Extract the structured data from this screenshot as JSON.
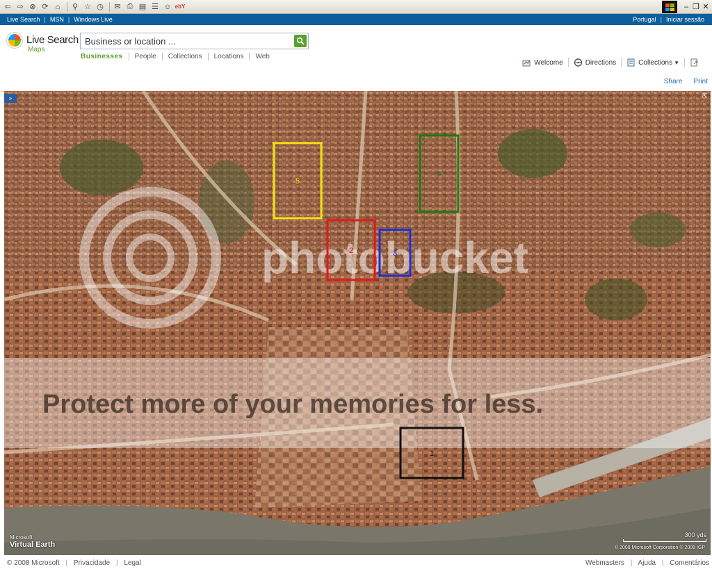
{
  "browser": {
    "toolbar_icons": [
      "back-icon",
      "forward-icon",
      "stop-icon",
      "refresh-icon",
      "home-icon",
      "search-icon",
      "favorites-icon",
      "history-icon",
      "mail-icon",
      "print-icon",
      "edit-icon",
      "discuss-icon",
      "messenger-icon",
      "ebay-icon"
    ],
    "ebay_label": "ebY"
  },
  "live_bar": {
    "links": [
      "Live Search",
      "MSN",
      "Windows Live"
    ],
    "right_links": [
      "Portugal",
      "Iniciar sessão"
    ]
  },
  "header": {
    "logo_title": "Live Search",
    "logo_subtitle": "Maps",
    "search_placeholder": "Business or location ...",
    "tabs": [
      "Businesses",
      "People",
      "Collections",
      "Locations",
      "Web"
    ],
    "actions": [
      "Welcome",
      "Directions",
      "Collections"
    ],
    "share": "Share",
    "print": "Print"
  },
  "map": {
    "expand_label": "»",
    "markers": [
      {
        "label": "1",
        "color": "#111111"
      },
      {
        "label": "2",
        "color": "#e01b1b"
      },
      {
        "label": "3",
        "color": "#1a2fd6"
      },
      {
        "label": "4",
        "color": "#1e7a12"
      },
      {
        "label": "5",
        "color": "#f2e313"
      }
    ],
    "watermark_brand": "photobucket",
    "watermark_banner": "Protect more of your memories for less.",
    "ve_microsoft": "Microsoft",
    "ve_title": "Virtual Earth",
    "scale_label": "300 yds",
    "copyright": "© 2008 Microsoft Corporation   © 2008 IGP"
  },
  "footer": {
    "left": [
      "© 2008 Microsoft",
      "Privacidade",
      "Legal"
    ],
    "right": [
      "Webmasters",
      "Ajuda",
      "Comentários"
    ]
  }
}
